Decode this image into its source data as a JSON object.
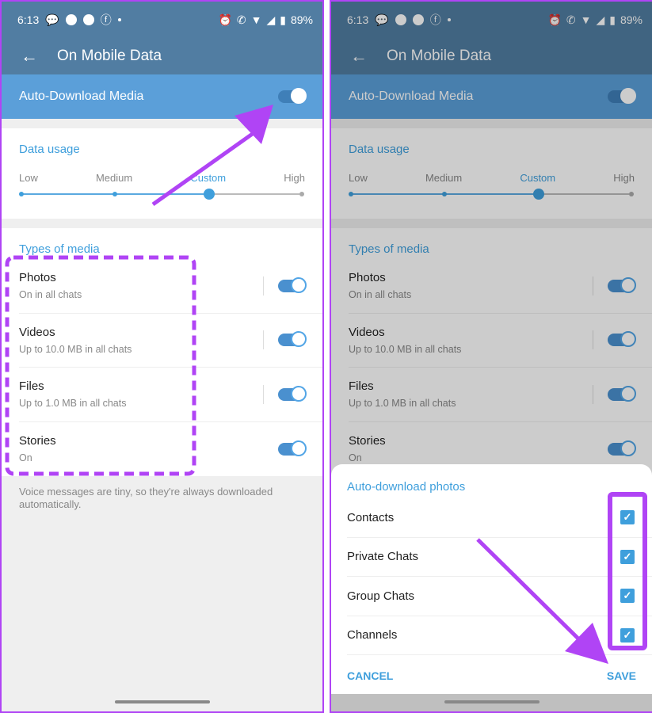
{
  "status": {
    "time": "6:13",
    "battery": "89%"
  },
  "appbar": {
    "title": "On Mobile Data",
    "back_icon": "←"
  },
  "master": {
    "label": "Auto-Download Media",
    "enabled": true
  },
  "data_usage": {
    "header": "Data usage",
    "levels": [
      "Low",
      "Medium",
      "Custom",
      "High"
    ],
    "selected": "Custom"
  },
  "media": {
    "header": "Types of media",
    "items": [
      {
        "title": "Photos",
        "subtitle": "On in all chats",
        "enabled": true
      },
      {
        "title": "Videos",
        "subtitle": "Up to 10.0 MB in all chats",
        "enabled": true
      },
      {
        "title": "Files",
        "subtitle": "Up to 1.0 MB in all chats",
        "enabled": true
      },
      {
        "title": "Stories",
        "subtitle": "On",
        "enabled": true
      }
    ]
  },
  "note": "Voice messages are tiny, so they're always downloaded automatically.",
  "dialog": {
    "header": "Auto-download photos",
    "options": [
      {
        "label": "Contacts",
        "checked": true
      },
      {
        "label": "Private Chats",
        "checked": true
      },
      {
        "label": "Group Chats",
        "checked": true
      },
      {
        "label": "Channels",
        "checked": true
      }
    ],
    "cancel": "CANCEL",
    "save": "SAVE"
  },
  "annotation_color": "#b044f5"
}
